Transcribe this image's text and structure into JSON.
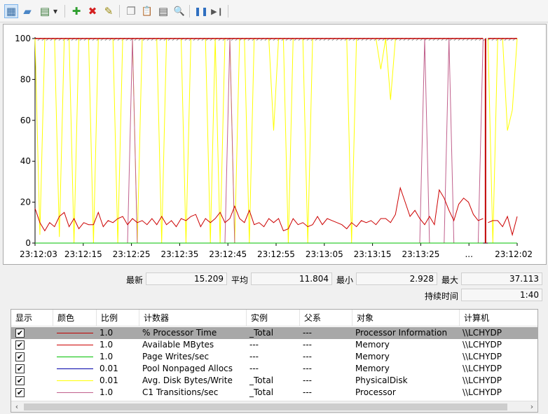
{
  "toolbar": {
    "items": [
      {
        "name": "view-graph-icon",
        "glyph": "▦",
        "color": "#3a6ea5",
        "selected": true
      },
      {
        "name": "view-histogram-icon",
        "glyph": "▰",
        "color": "#4a86c6"
      },
      {
        "name": "change-graph-type-icon",
        "glyph": "▤",
        "color": "#3a7a3a"
      },
      {
        "name": "dropdown-arrow-icon",
        "glyph": "▾",
        "color": "#333333"
      },
      {
        "name": "add-counter-icon",
        "glyph": "✚",
        "color": "#2e9e2e"
      },
      {
        "name": "delete-counter-icon",
        "glyph": "✖",
        "color": "#d42020"
      },
      {
        "name": "highlight-icon",
        "glyph": "✎",
        "color": "#9a8a10"
      },
      {
        "name": "copy-properties-icon",
        "glyph": "❐",
        "color": "#888888"
      },
      {
        "name": "paste-counter-list-icon",
        "glyph": "📋",
        "color": "#7a6a3a"
      },
      {
        "name": "properties-icon",
        "glyph": "▤",
        "color": "#555555"
      },
      {
        "name": "zoom-icon",
        "glyph": "🔍",
        "color": "#666666"
      },
      {
        "name": "freeze-display-icon",
        "glyph": "❚❚",
        "color": "#2f6fc0"
      },
      {
        "name": "update-data-icon",
        "glyph": "▶❙",
        "color": "#555555"
      }
    ]
  },
  "chart_data": {
    "type": "line",
    "title": "",
    "xlabel": "",
    "ylabel": "",
    "ylim": [
      0,
      100
    ],
    "yticks": [
      "0",
      "20",
      "40",
      "60",
      "80",
      "100"
    ],
    "xtick_labels": [
      "23:12:03",
      "23:12:15",
      "23:12:25",
      "23:12:35",
      "23:12:45",
      "23:12:55",
      "23:13:05",
      "23:13:15",
      "23:13:25",
      "...",
      "23:12:02"
    ],
    "grid": false,
    "samples": 100,
    "series": [
      {
        "color": "#ffff00",
        "values": [
          100,
          4,
          100,
          100,
          100,
          3,
          100,
          100,
          0,
          100,
          100,
          100,
          0,
          100,
          100,
          100,
          100,
          0,
          100,
          100,
          100,
          0,
          100,
          100,
          100,
          100,
          0,
          100,
          100,
          100,
          100,
          0,
          100,
          100,
          100,
          100,
          0,
          100,
          0,
          100,
          100,
          0,
          100,
          100,
          0,
          100,
          100,
          100,
          100,
          55,
          100,
          100,
          0,
          100,
          100,
          100,
          0,
          100,
          100,
          100,
          100,
          100,
          100,
          100,
          100,
          0,
          100,
          100,
          100,
          100,
          100,
          85,
          100,
          70,
          100,
          100,
          100,
          100,
          100,
          100,
          100,
          100,
          100,
          100,
          100,
          100,
          100,
          100,
          100,
          100,
          100,
          100,
          100,
          100,
          0,
          100,
          100,
          55,
          65,
          100
        ]
      },
      {
        "color": "#c0608c",
        "values": [
          0,
          0,
          0,
          0,
          0,
          0,
          0,
          0,
          0,
          0,
          0,
          0,
          0,
          0,
          0,
          0,
          0,
          0,
          0,
          0,
          100,
          0,
          0,
          0,
          0,
          0,
          0,
          0,
          0,
          0,
          0,
          0,
          0,
          0,
          0,
          0,
          0,
          0,
          0,
          0,
          100,
          0,
          0,
          0,
          0,
          0,
          0,
          0,
          0,
          0,
          0,
          0,
          0,
          0,
          0,
          0,
          0,
          0,
          0,
          0,
          0,
          0,
          0,
          0,
          0,
          0,
          0,
          0,
          0,
          0,
          0,
          0,
          0,
          0,
          0,
          0,
          0,
          0,
          0,
          0,
          100,
          0,
          0,
          0,
          0,
          100,
          0,
          0,
          0,
          0,
          0,
          0,
          100,
          0,
          0,
          0,
          0,
          0,
          0,
          0
        ]
      },
      {
        "color": "#00c000",
        "values": [
          0,
          0,
          0,
          0,
          0,
          0,
          0,
          0,
          0,
          0,
          0,
          0,
          0,
          0,
          0,
          0,
          0,
          0,
          0,
          0,
          0,
          0,
          0,
          0,
          0,
          0,
          0,
          0,
          0,
          0,
          0,
          0,
          0,
          0,
          0,
          0,
          0,
          0,
          0,
          0,
          0,
          0,
          0,
          0,
          0,
          0,
          0,
          0,
          0,
          0,
          0,
          0,
          0,
          0,
          0,
          0,
          0,
          0,
          0,
          0,
          0,
          0,
          0,
          0,
          0,
          0,
          0,
          0,
          0,
          0,
          0,
          0,
          0,
          0,
          0,
          0,
          0,
          0,
          0,
          0,
          0,
          0,
          0,
          0,
          0,
          0,
          0,
          0,
          0,
          0,
          0,
          0,
          0,
          0,
          0,
          0,
          0,
          0,
          0,
          0
        ]
      },
      {
        "color": "#c00000",
        "values": [
          100,
          100,
          100,
          100,
          100,
          100,
          100,
          100,
          100,
          100,
          100,
          100,
          100,
          100,
          100,
          100,
          100,
          100,
          100,
          100,
          100,
          100,
          100,
          100,
          100,
          100,
          100,
          100,
          100,
          100,
          100,
          100,
          100,
          100,
          100,
          100,
          100,
          100,
          100,
          100,
          100,
          100,
          100,
          100,
          100,
          100,
          100,
          100,
          100,
          100,
          100,
          100,
          100,
          100,
          100,
          100,
          100,
          100,
          100,
          100,
          100,
          100,
          100,
          100,
          100,
          100,
          100,
          100,
          100,
          100,
          100,
          100,
          100,
          100,
          100,
          100,
          100,
          100,
          100,
          100,
          100,
          100,
          100,
          100,
          100,
          100,
          100,
          100,
          100,
          100,
          100,
          100,
          100,
          100,
          100,
          100,
          100,
          100,
          100,
          100
        ]
      },
      {
        "color": "#cc0000",
        "values": [
          17,
          10,
          6,
          10,
          8,
          13,
          15,
          8,
          12,
          7,
          10,
          9,
          9,
          15,
          8,
          11,
          10,
          12,
          13,
          9,
          12,
          10,
          11,
          9,
          12,
          9,
          13,
          9,
          11,
          8,
          12,
          11,
          13,
          14,
          8,
          12,
          10,
          12,
          15,
          10,
          12,
          18,
          12,
          10,
          16,
          9,
          10,
          8,
          12,
          10,
          12,
          6,
          7,
          12,
          9,
          10,
          8,
          9,
          13,
          9,
          12,
          11,
          10,
          9,
          7,
          10,
          8,
          11,
          10,
          11,
          9,
          12,
          12,
          10,
          14,
          27,
          20,
          13,
          16,
          12,
          9,
          13,
          9,
          26,
          22,
          16,
          11,
          19,
          22,
          20,
          14,
          11,
          12,
          10,
          11,
          11,
          8,
          13,
          4,
          13
        ]
      }
    ]
  },
  "stats": {
    "last_label": "最新",
    "last_value": "15.209",
    "avg_label": "平均",
    "avg_value": "11.804",
    "min_label": "最小",
    "min_value": "2.928",
    "max_label": "最大",
    "max_value": "37.113",
    "duration_label": "持续时间",
    "duration_value": "1:40"
  },
  "table": {
    "headers": [
      "显示",
      "颜色",
      "比例",
      "计数器",
      "实例",
      "父系",
      "对象",
      "计算机"
    ],
    "rows": [
      {
        "checked": "✔",
        "color": "#c00000",
        "scale": "1.0",
        "counter": "% Processor Time",
        "instance": "_Total",
        "parent": "---",
        "object": "Processor Information",
        "computer": "\\\\LCHYDP",
        "selected": true
      },
      {
        "checked": "✔",
        "color": "#cc0000",
        "scale": "1.0",
        "counter": "Available MBytes",
        "instance": "---",
        "parent": "---",
        "object": "Memory",
        "computer": "\\\\LCHYDP"
      },
      {
        "checked": "✔",
        "color": "#00c000",
        "scale": "1.0",
        "counter": "Page Writes/sec",
        "instance": "---",
        "parent": "---",
        "object": "Memory",
        "computer": "\\\\LCHYDP"
      },
      {
        "checked": "✔",
        "color": "#0000aa",
        "scale": "0.01",
        "counter": "Pool Nonpaged Allocs",
        "instance": "---",
        "parent": "---",
        "object": "Memory",
        "computer": "\\\\LCHYDP"
      },
      {
        "checked": "✔",
        "color": "#ffff00",
        "scale": "0.01",
        "counter": "Avg. Disk Bytes/Write",
        "instance": "_Total",
        "parent": "---",
        "object": "PhysicalDisk",
        "computer": "\\\\LCHYDP"
      },
      {
        "checked": "✔",
        "color": "#c0608c",
        "scale": "1.0",
        "counter": "C1 Transitions/sec",
        "instance": "_Total",
        "parent": "---",
        "object": "Processor",
        "computer": "\\\\LCHYDP"
      }
    ]
  }
}
